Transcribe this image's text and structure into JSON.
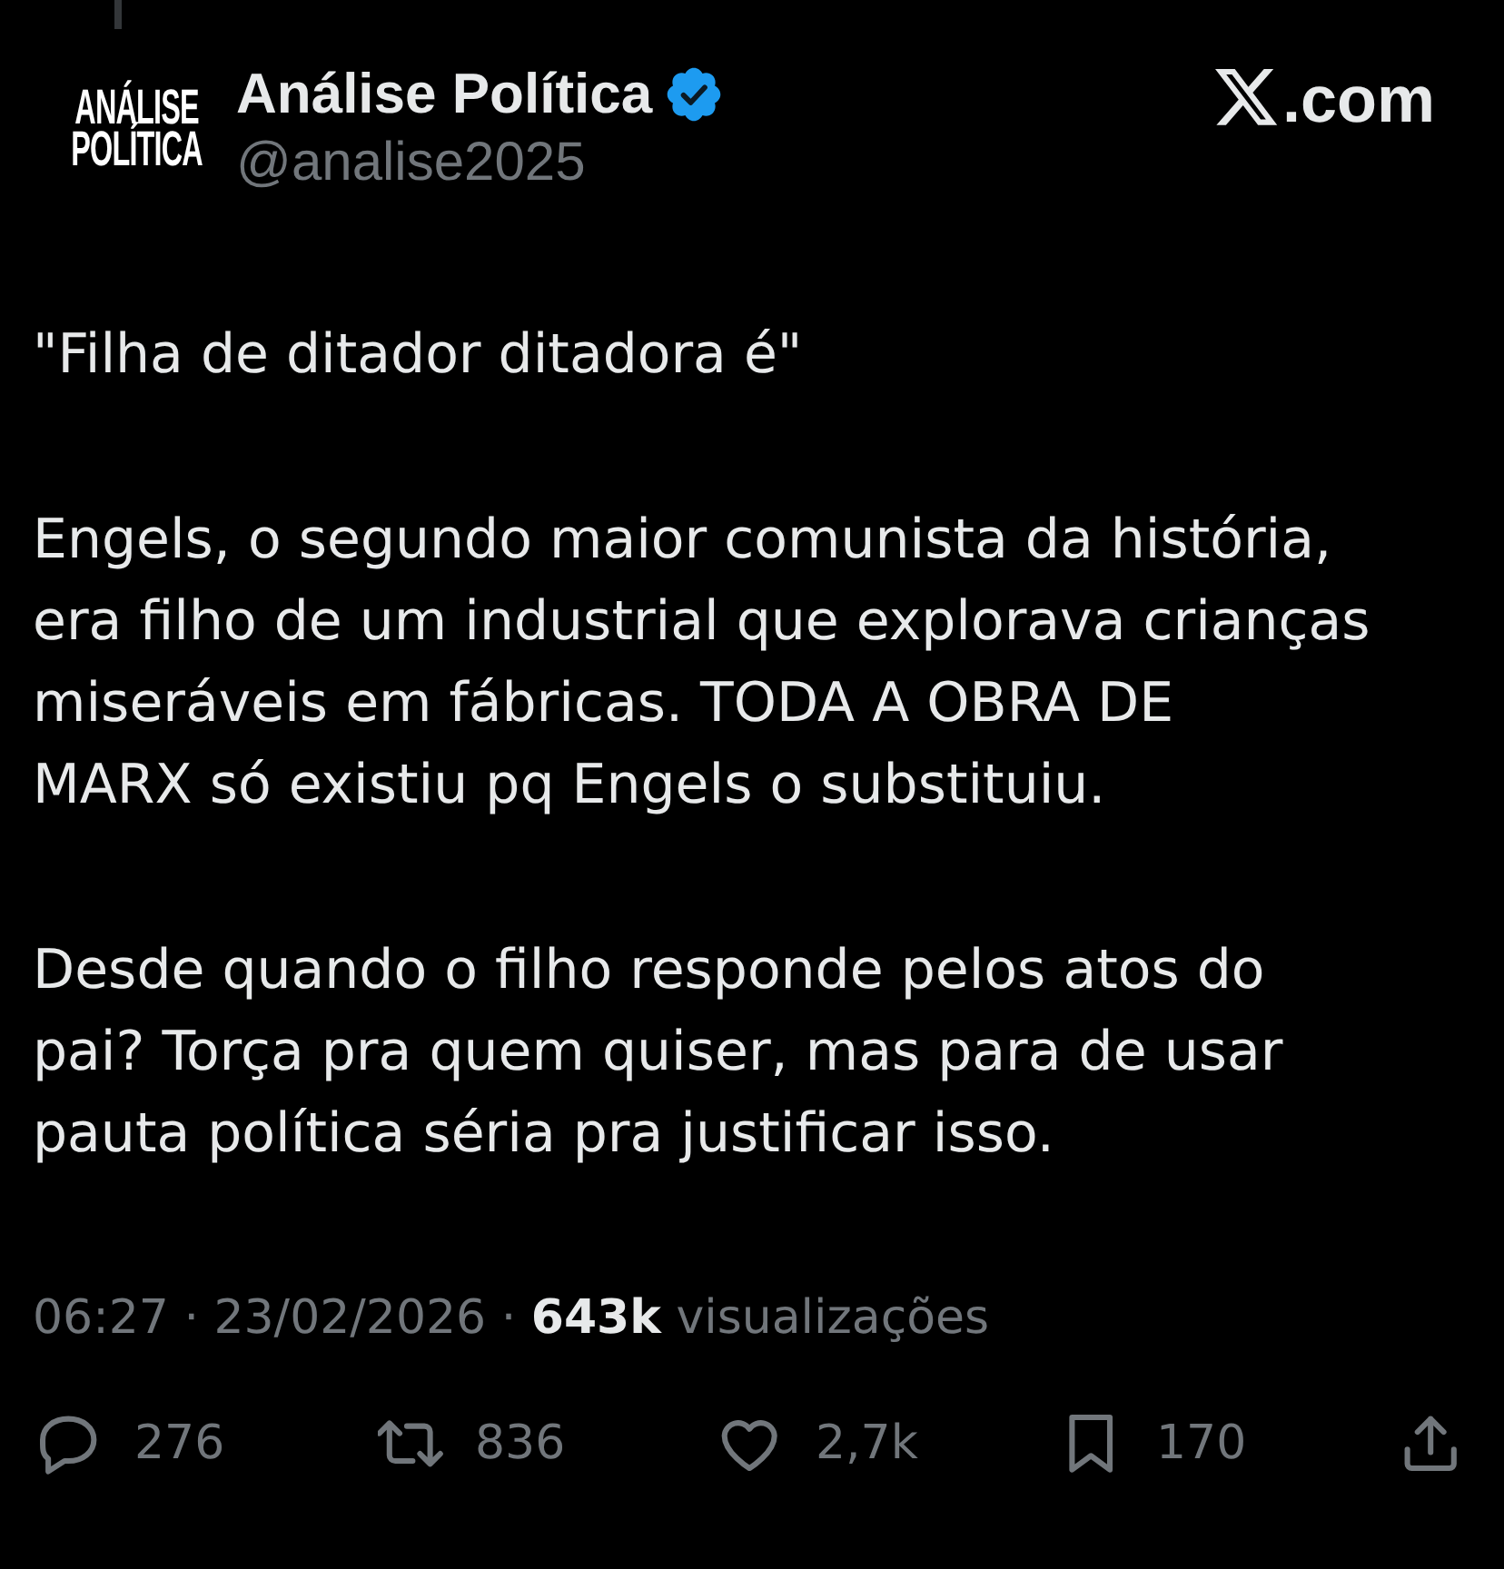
{
  "author": {
    "logo_text": "ANÁLISE\nPOLÍTICA",
    "name": "Análise Política",
    "verified": true,
    "handle": "@analise2025"
  },
  "source": {
    "logo_suffix": ".com"
  },
  "post": {
    "paragraphs": [
      "\"Filha de ditador ditadora é\"",
      "Engels, o segundo maior comunista da história,\nera filho de um industrial que explorava crianças\nmiseráveis em fábricas. TODA A OBRA DE\nMARX só existiu pq Engels o substituiu.",
      "Desde quando o filho responde pelos atos do\npai? Torça pra quem quiser, mas para de usar\npauta política séria pra justificar isso."
    ]
  },
  "meta": "06:27 · 23/02/2026 · **643k** visualizações",
  "actions": [
    {
      "kind": "reply",
      "count": "276"
    },
    {
      "kind": "repost",
      "count": "836"
    },
    {
      "kind": "like",
      "count": "2,7k"
    },
    {
      "kind": "bookmark",
      "count": "170"
    },
    {
      "kind": "share"
    }
  ]
}
